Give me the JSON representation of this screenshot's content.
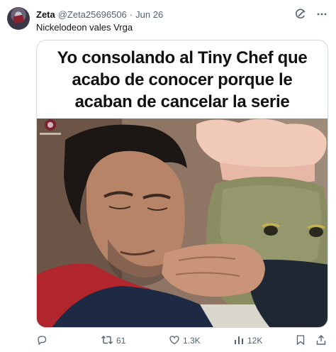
{
  "author": {
    "name": "Zeta",
    "handle": "@Zeta25696506",
    "separator": "·",
    "date": "Jun 26",
    "avatar_icon": "avatar-icon"
  },
  "tweet": {
    "text": "Nickelodeon vales Vrga"
  },
  "meme": {
    "caption": "Yo consolando al Tiny Chef que acabo de conocer porque le acaban de cancelar la serie",
    "watermark_label": "watermark-logo"
  },
  "actions": {
    "reply_icon": "reply-icon",
    "repost_count": "61",
    "like_count": "1.3K",
    "views_count": "12K",
    "bookmark_icon": "bookmark-icon",
    "share_icon": "share-icon"
  },
  "colors": {
    "text": "#0f1419",
    "secondary": "#536471",
    "border": "#cfd9de"
  }
}
